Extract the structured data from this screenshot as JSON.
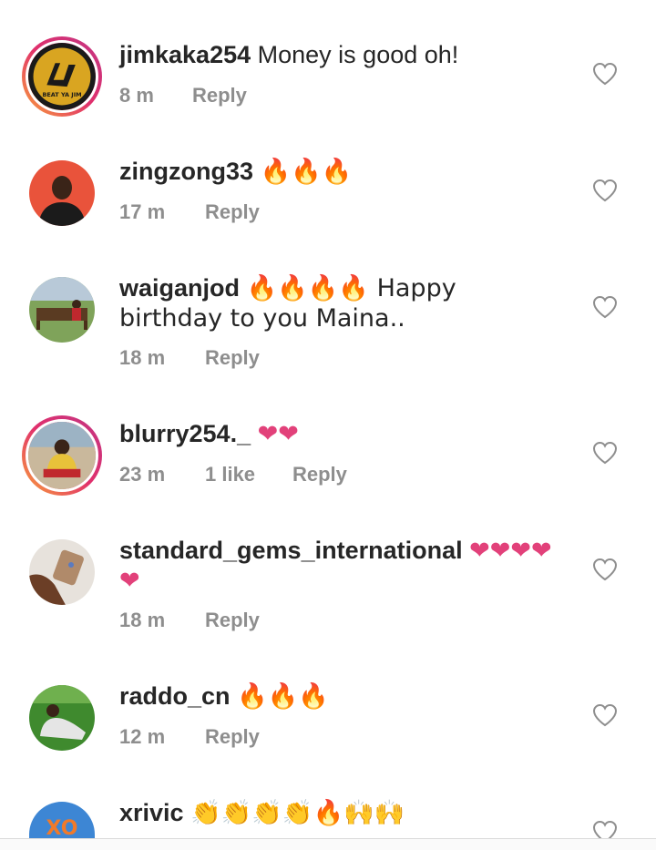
{
  "comments": [
    {
      "username": "jimkaka254",
      "text": "Money is good oh!",
      "time": "8 m",
      "likes": "",
      "reply": "Reply",
      "avatar_label": "BEAT YA JIM"
    },
    {
      "username": "zingzong33",
      "text": "🔥🔥🔥",
      "time": "17 m",
      "likes": "",
      "reply": "Reply"
    },
    {
      "username": "waiganjod",
      "text": "🔥🔥🔥🔥 Happy birthday to you Maina..",
      "time": "18 m",
      "likes": "",
      "reply": "Reply"
    },
    {
      "username": "blurry254._",
      "text": "❤❤",
      "time": "23 m",
      "likes": "1 like",
      "reply": "Reply"
    },
    {
      "username": "standard_gems_international",
      "text": "❤❤❤❤❤",
      "time": "18 m",
      "likes": "",
      "reply": "Reply"
    },
    {
      "username": "raddo_cn",
      "text": "🔥🔥🔥",
      "time": "12 m",
      "likes": "",
      "reply": "Reply"
    },
    {
      "username": "xrivic",
      "text": "👏👏👏👏🔥🙌🙌",
      "time": "",
      "likes": "",
      "reply": ""
    }
  ],
  "colors": {
    "text": "#262626",
    "meta": "#8e8e8e",
    "heart_outline": "#8e8e8e",
    "story_ring_start": "#f9a33a",
    "story_ring_end": "#c13584"
  },
  "icons": {
    "like": "heart-outline-icon"
  }
}
